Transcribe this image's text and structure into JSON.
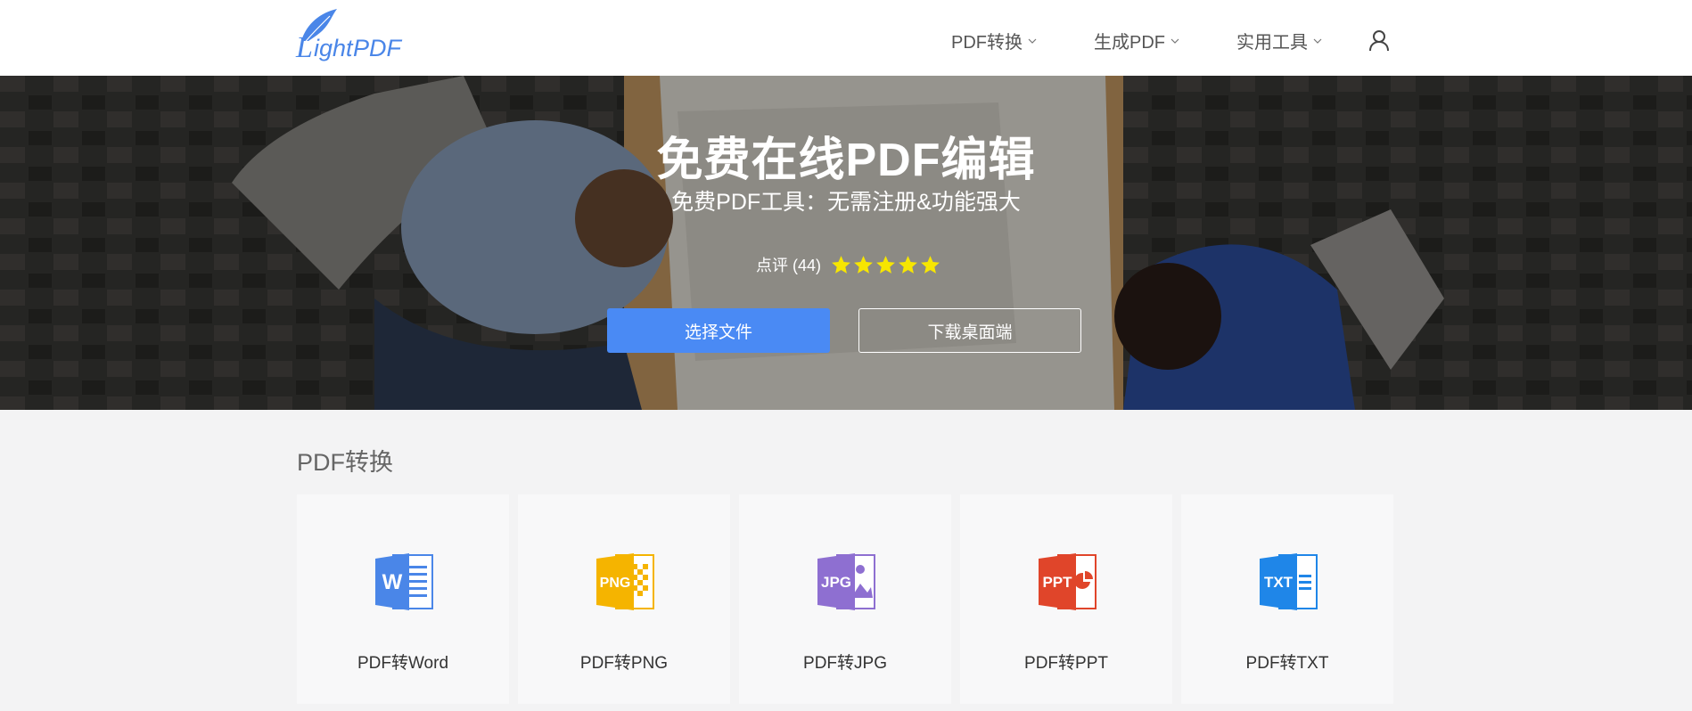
{
  "header": {
    "logo_text": "LightPDF",
    "nav": [
      {
        "label": "PDF转换"
      },
      {
        "label": "生成PDF"
      },
      {
        "label": "实用工具"
      }
    ]
  },
  "hero": {
    "title": "免费在线PDF编辑",
    "subtitle": "免费PDF工具：无需注册&功能强大",
    "rating_label": "点评 (44)",
    "rating_stars": 5,
    "star_color": "#f7e600",
    "primary_button": "选择文件",
    "secondary_button": "下载桌面端"
  },
  "section": {
    "title": "PDF转换",
    "cards": [
      {
        "label": "PDF转Word",
        "icon": "word-icon",
        "badge": "W",
        "color": "#4a86e8"
      },
      {
        "label": "PDF转PNG",
        "icon": "png-icon",
        "badge": "PNG",
        "color": "#f5b400"
      },
      {
        "label": "PDF转JPG",
        "icon": "jpg-icon",
        "badge": "JPG",
        "color": "#8e6fd1"
      },
      {
        "label": "PDF转PPT",
        "icon": "ppt-icon",
        "badge": "PPT",
        "color": "#e0452a"
      },
      {
        "label": "PDF转TXT",
        "icon": "txt-icon",
        "badge": "TXT",
        "color": "#1f86e8"
      }
    ]
  },
  "colors": {
    "accent": "#4a8af4",
    "page_bg": "#f3f3f4",
    "card_bg": "#f8f8f9"
  }
}
